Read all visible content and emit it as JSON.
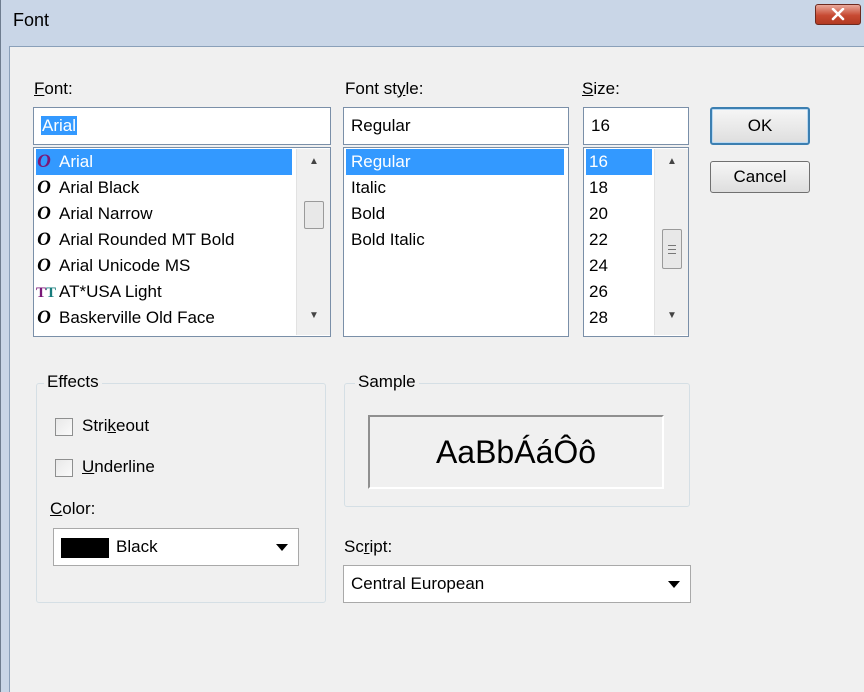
{
  "window": {
    "title": "Font"
  },
  "font": {
    "label_pre": "",
    "label_u": "F",
    "label_post": "ont:",
    "value": "Arial",
    "items": [
      {
        "label": "Arial",
        "icon": "opentype-icon",
        "glyph": "O",
        "selected": true
      },
      {
        "label": "Arial Black",
        "icon": "opentype-icon",
        "glyph": "O"
      },
      {
        "label": "Arial Narrow",
        "icon": "opentype-icon",
        "glyph": "O"
      },
      {
        "label": "Arial Rounded MT Bold",
        "icon": "opentype-icon",
        "glyph": "O"
      },
      {
        "label": "Arial Unicode MS",
        "icon": "opentype-icon",
        "glyph": "O"
      },
      {
        "label": "AT*USA Light",
        "icon": "truetype-icon",
        "glyph": "TT"
      },
      {
        "label": "Baskerville Old Face",
        "icon": "opentype-icon",
        "glyph": "O"
      }
    ]
  },
  "font_style": {
    "label_pre": "Font st",
    "label_u": "y",
    "label_post": "le:",
    "value": "Regular",
    "items": [
      "Regular",
      "Italic",
      "Bold",
      "Bold Italic"
    ]
  },
  "size": {
    "label_pre": "",
    "label_u": "S",
    "label_post": "ize:",
    "value": "16",
    "items": [
      "16",
      "18",
      "20",
      "22",
      "24",
      "26",
      "28"
    ]
  },
  "buttons": {
    "ok": "OK",
    "cancel": "Cancel"
  },
  "effects": {
    "title": "Effects",
    "strikeout_pre": "Stri",
    "strikeout_u": "k",
    "strikeout_post": "eout",
    "strikeout_checked": false,
    "underline_pre": "",
    "underline_u": "U",
    "underline_post": "nderline",
    "underline_checked": false,
    "color_pre": "",
    "color_u": "C",
    "color_post": "olor:",
    "color_value": "Black",
    "color_swatch": "#000000"
  },
  "sample": {
    "title": "Sample",
    "text": "AaBbÁáÔô"
  },
  "script": {
    "label_pre": "Sc",
    "label_u": "r",
    "label_post": "ipt:",
    "value": "Central European"
  },
  "colors": {
    "selection": "#3399ff",
    "dialog_bg": "#f0f0f0",
    "close_button": "#c74a32",
    "opentype_icon": "#000000",
    "opentype_icon_selected": "#7a1878"
  }
}
